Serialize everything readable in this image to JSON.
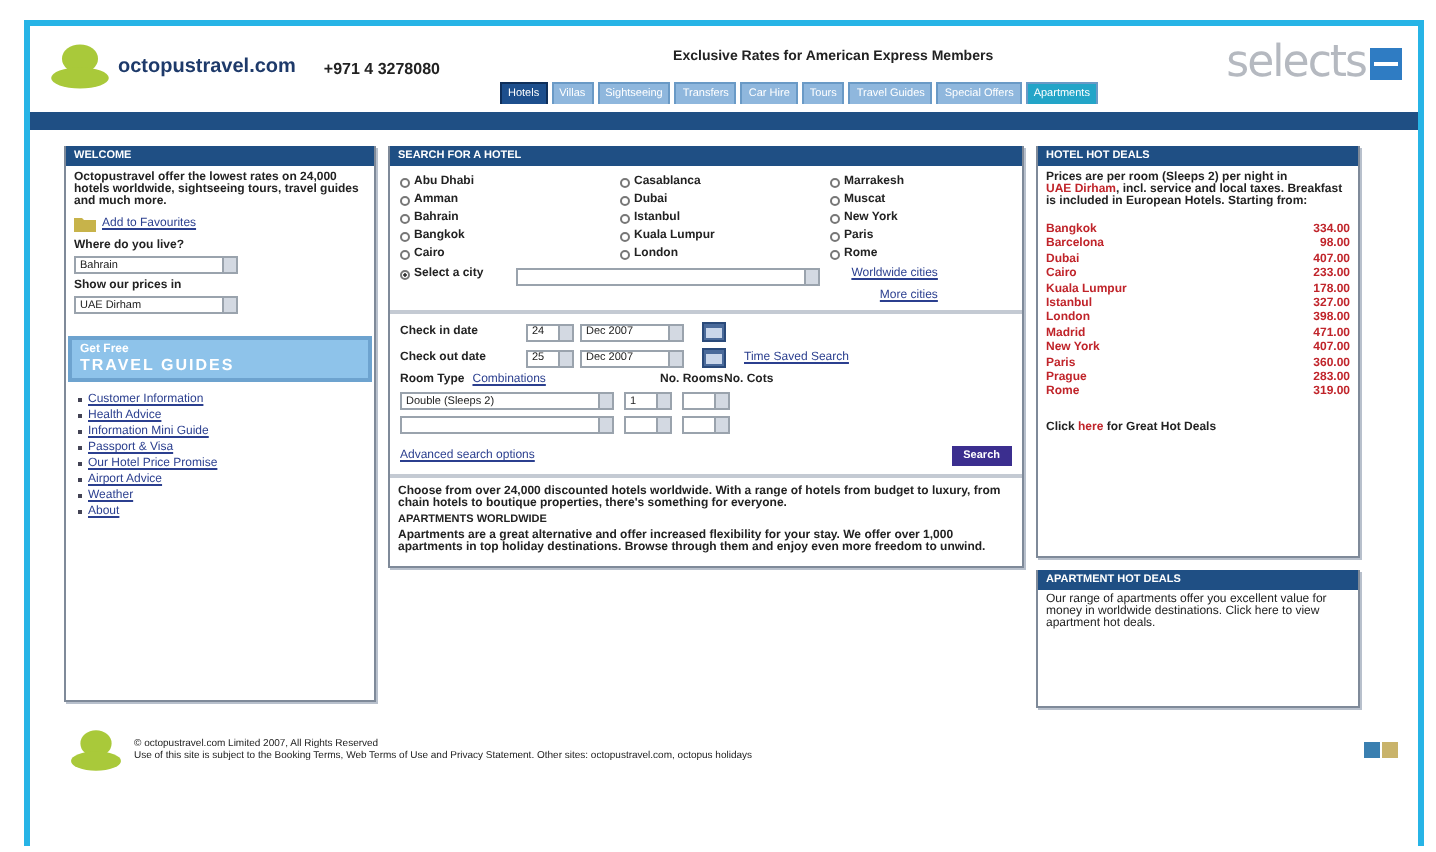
{
  "header": {
    "site_name": "octopustravel.com",
    "phone": "+971 4 3278080",
    "headline": "Exclusive Rates for American Express Members",
    "partner_logo": "selects"
  },
  "tabs": [
    {
      "label": "Hotels",
      "selected": true,
      "kind": "standard"
    },
    {
      "label": "Villas",
      "selected": false,
      "kind": "standard"
    },
    {
      "label": "Sightseeing",
      "selected": false,
      "kind": "standard"
    },
    {
      "label": "Transfers",
      "selected": false,
      "kind": "standard"
    },
    {
      "label": "Car Hire",
      "selected": false,
      "kind": "standard"
    },
    {
      "label": "Tours",
      "selected": false,
      "kind": "standard"
    },
    {
      "label": "Travel Guides",
      "selected": false,
      "kind": "standard"
    },
    {
      "label": "Special Offers",
      "selected": false,
      "kind": "standard"
    },
    {
      "label": "Apartments",
      "selected": false,
      "kind": "featured"
    }
  ],
  "welcome": {
    "title": "WELCOME",
    "intro": "Octopustravel offer the lowest rates on 24,000 hotels worldwide, sightseeing tours, travel guides and much more.",
    "favourites_link": "Add to Favourites",
    "live_label": "Where do you live?",
    "live_value": "Bahrain",
    "currency_label": "Show our prices in",
    "currency_value": "UAE Dirham",
    "promo_small": "Get Free",
    "promo_title": "TRAVEL GUIDES",
    "links": [
      "Customer Information",
      "Health Advice",
      "Information Mini Guide",
      "Passport & Visa",
      "Our Hotel Price Promise",
      "Airport Advice",
      "Weather",
      "About"
    ]
  },
  "search": {
    "title": "SEARCH FOR A HOTEL",
    "cities": [
      {
        "label": "Abu Dhabi",
        "selected": false
      },
      {
        "label": "Casablanca",
        "selected": false
      },
      {
        "label": "Marrakesh",
        "selected": false
      },
      {
        "label": "Amman",
        "selected": false
      },
      {
        "label": "Dubai",
        "selected": false
      },
      {
        "label": "Muscat",
        "selected": false
      },
      {
        "label": "Bahrain",
        "selected": false
      },
      {
        "label": "Istanbul",
        "selected": false
      },
      {
        "label": "New York",
        "selected": false
      },
      {
        "label": "Bangkok",
        "selected": false
      },
      {
        "label": "Kuala Lumpur",
        "selected": false
      },
      {
        "label": "Paris",
        "selected": false
      },
      {
        "label": "Cairo",
        "selected": false
      },
      {
        "label": "London",
        "selected": false
      },
      {
        "label": "Rome",
        "selected": false
      }
    ],
    "other_city": {
      "label": "Select a city",
      "selected": true
    },
    "city_links": [
      "Worldwide cities",
      "More cities"
    ],
    "checkin_label": "Check in date",
    "checkin_day": "24",
    "checkin_month": "Dec 2007",
    "checkout_label": "Check out date",
    "checkout_day": "25",
    "checkout_month": "Dec 2007",
    "saved_link": "Time Saved Search",
    "room_type_label": "Room Type",
    "combinations_link": "Combinations",
    "rooms_label": "No. Rooms",
    "cots_label": "No. Cots",
    "room_rows": [
      {
        "type": "Double (Sleeps 2)",
        "rooms": "1"
      },
      {
        "type": "",
        "rooms": ""
      }
    ],
    "advanced_link": "Advanced search options",
    "search_button": "Search"
  },
  "info": {
    "hotels_text": "Choose from over 24,000 discounted hotels worldwide. With a range of hotels from budget to luxury, from chain hotels to boutique properties, there's something for everyone.",
    "apartments_heading": "APARTMENTS WORLDWIDE",
    "apartments_text": "Apartments are a great alternative and offer increased flexibility for your stay. We offer over 1,000 apartments in top holiday destinations. Browse through them and enjoy even more freedom to unwind."
  },
  "hot_deals": {
    "title": "HOTEL HOT DEALS",
    "intro_before": "Prices are per room (Sleeps 2) per night in ",
    "intro_link": "UAE Dirham",
    "intro_after": ", incl. service and local taxes. Breakfast is included in European Hotels. Starting from:",
    "deals": [
      {
        "city": "Bangkok",
        "price": "334.00"
      },
      {
        "city": "Barcelona",
        "price": "98.00"
      },
      {
        "city": "Dubai",
        "price": "407.00"
      },
      {
        "city": "Cairo",
        "price": "233.00"
      },
      {
        "city": "Kuala Lumpur",
        "price": "178.00"
      },
      {
        "city": "Istanbul",
        "price": "327.00"
      },
      {
        "city": "London",
        "price": "398.00"
      },
      {
        "city": "Madrid",
        "price": "471.00"
      },
      {
        "city": "New York",
        "price": "407.00"
      },
      {
        "city": "Paris",
        "price": "360.00"
      },
      {
        "city": "Prague",
        "price": "283.00"
      },
      {
        "city": "Rome",
        "price": "319.00"
      }
    ],
    "footer_before": "Click ",
    "footer_link": "here",
    "footer_after": " for Great Hot Deals"
  },
  "apartment_deals": {
    "title": "APARTMENT HOT DEALS",
    "text": "Our range of apartments offer you excellent value for money in worldwide destinations. Click here to view apartment hot deals."
  },
  "footer": {
    "copyright": "© octopustravel.com Limited 2007, All Rights Reserved",
    "terms": "Use of this site is subject to the Booking Terms, Web Terms of Use and Privacy Statement. Other sites: octopustravel.com, octopus holidays"
  }
}
